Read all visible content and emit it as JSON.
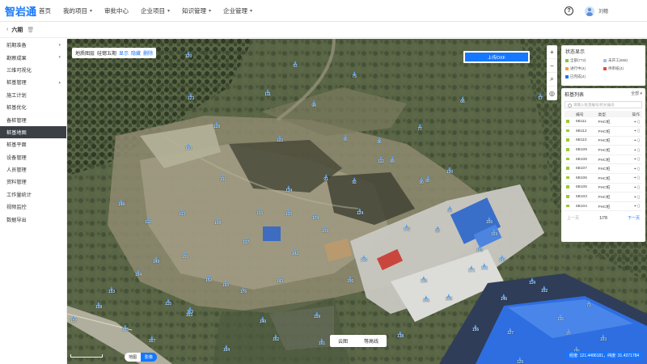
{
  "app": {
    "logo": "智岩通",
    "user": "刘穗"
  },
  "nav": [
    {
      "label": "首页",
      "dropdown": false
    },
    {
      "label": "我的项目",
      "dropdown": true
    },
    {
      "label": "审批中心",
      "dropdown": false
    },
    {
      "label": "企业项目",
      "dropdown": true
    },
    {
      "label": "知识管理",
      "dropdown": true
    },
    {
      "label": "企业管理",
      "dropdown": true
    }
  ],
  "subheader": {
    "stage": "六期"
  },
  "sidebar": [
    {
      "label": "前期准备",
      "arrow": true,
      "active": false
    },
    {
      "label": "勘察成果",
      "arrow": true,
      "active": false
    },
    {
      "label": "三维可视化",
      "arrow": false,
      "active": false
    },
    {
      "label": "桩基管理",
      "arrow": true,
      "active": false
    },
    {
      "label": "施工计划",
      "arrow": false,
      "active": false
    },
    {
      "label": "桩基优化",
      "arrow": false,
      "active": false
    },
    {
      "label": "备桩管理",
      "arrow": false,
      "active": false
    },
    {
      "label": "桩基地图",
      "arrow": false,
      "active": true
    },
    {
      "label": "桩基平面",
      "arrow": false,
      "active": false
    },
    {
      "label": "设备管理",
      "arrow": false,
      "active": false
    },
    {
      "label": "人员管理",
      "arrow": false,
      "active": false
    },
    {
      "label": "资料管理",
      "arrow": false,
      "active": false
    },
    {
      "label": "工作量统计",
      "arrow": false,
      "active": false
    },
    {
      "label": "视频监控",
      "arrow": false,
      "active": false
    },
    {
      "label": "数据导出",
      "arrow": false,
      "active": false
    }
  ],
  "map": {
    "layer_control": {
      "label": "地质图层",
      "layer": "硅锶五期",
      "show": "显示",
      "hide": "隐藏",
      "delete": "删除"
    },
    "upload_label": "上传DXF",
    "zoom_buttons": [
      "+",
      "−",
      "⌕",
      "◎"
    ],
    "mode_tabs": [
      "云图",
      "等高线"
    ],
    "base_tabs": [
      "地图",
      "影像"
    ],
    "coords": "经度: 121.4486181，纬度: 31.4371784",
    "markers": [
      "120",
      "93",
      "75",
      "123",
      "111",
      "94",
      "66",
      "57",
      "128",
      "95",
      "122",
      "96",
      "77",
      "89",
      "100",
      "90",
      "112",
      "130",
      "131",
      "134",
      "91",
      "92",
      "80",
      "98",
      "148",
      "133",
      "136",
      "135",
      "174",
      "139",
      "124",
      "112",
      "149",
      "108",
      "137",
      "142",
      "126",
      "132",
      "85",
      "153",
      "150",
      "154",
      "152",
      "160",
      "176",
      "143",
      "125",
      "115",
      "113",
      "106",
      "157",
      "158",
      "155",
      "163",
      "140",
      "159",
      "167",
      "164",
      "162",
      "161",
      "170",
      "138",
      "151",
      "105",
      "141",
      "144",
      "156",
      "127",
      "97",
      "73",
      "116",
      "103",
      "145",
      "129",
      "114",
      "102",
      "146",
      "169",
      "166",
      "165",
      "171"
    ]
  },
  "status_panel": {
    "title": "状态显示",
    "items": [
      {
        "label": "全部(772)",
        "color": "#7ac943"
      },
      {
        "label": "未开工(668)",
        "color": "#9fc3e8"
      },
      {
        "label": "进行中(4)",
        "color": "#f0a040"
      },
      {
        "label": "待审核(4)",
        "color": "#e04a4a"
      },
      {
        "label": "已完成(4)",
        "color": "#1677ff"
      }
    ]
  },
  "pile_panel": {
    "title": "桩基列表",
    "filter": "全部",
    "search_placeholder": "请输入桩基编号/机长编号",
    "columns": [
      "编号",
      "类型",
      "操作"
    ],
    "rows": [
      {
        "id": "6B111",
        "type": "PHC桩"
      },
      {
        "id": "6B112",
        "type": "PHC桩"
      },
      {
        "id": "6B110",
        "type": "PHC桩"
      },
      {
        "id": "6B109",
        "type": "PHC桩"
      },
      {
        "id": "6B108",
        "type": "PHC桩"
      },
      {
        "id": "6B107",
        "type": "PHC桩"
      },
      {
        "id": "6B106",
        "type": "PHC桩"
      },
      {
        "id": "6B105",
        "type": "PHC桩"
      },
      {
        "id": "6B103",
        "type": "PHC桩"
      },
      {
        "id": "6B104",
        "type": "PHC桩"
      }
    ],
    "prev": "上一页",
    "page": "1/78",
    "next": "下一页"
  }
}
